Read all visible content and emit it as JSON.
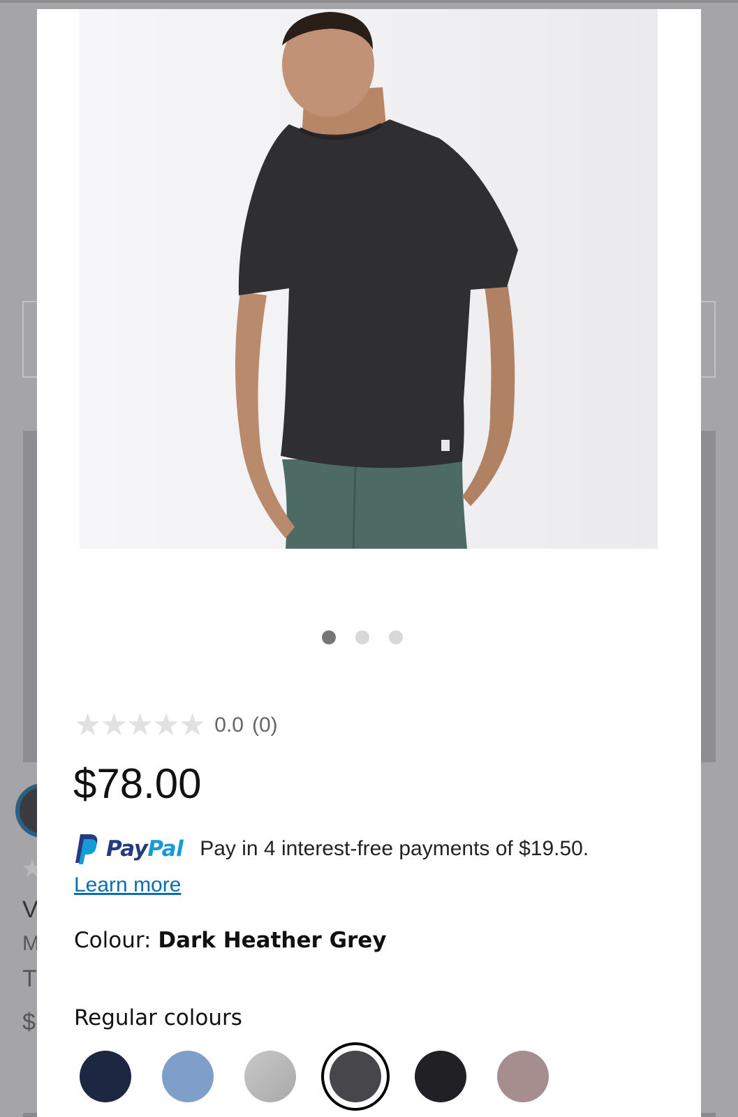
{
  "rating": {
    "value": "0.0",
    "count": "(0)",
    "stars_filled": 0,
    "stars_total": 5
  },
  "price": "$78.00",
  "paypal": {
    "brand_pay": "Pay",
    "brand_pal": "Pal",
    "message": "Pay in 4 interest-free payments of $19.50.",
    "learn_more": "Learn more"
  },
  "colour": {
    "label": "Colour:",
    "selected": "Dark Heather Grey"
  },
  "regular_colours": {
    "heading": "Regular colours",
    "swatches": [
      {
        "color": "#1c2842"
      },
      {
        "color": "#7f9fcb"
      },
      {
        "color": "#bdbdbd"
      },
      {
        "color": "#47474b",
        "selected": true
      },
      {
        "color": "#202025"
      },
      {
        "color": "#a68d8e"
      }
    ]
  },
  "gallery": {
    "slide_count": 3,
    "active_slide": 1
  },
  "colors": {
    "paypal_dark": "#253b80",
    "paypal_light": "#179bd7",
    "link": "#0b6db4",
    "star_empty": "#e1e1e1"
  }
}
